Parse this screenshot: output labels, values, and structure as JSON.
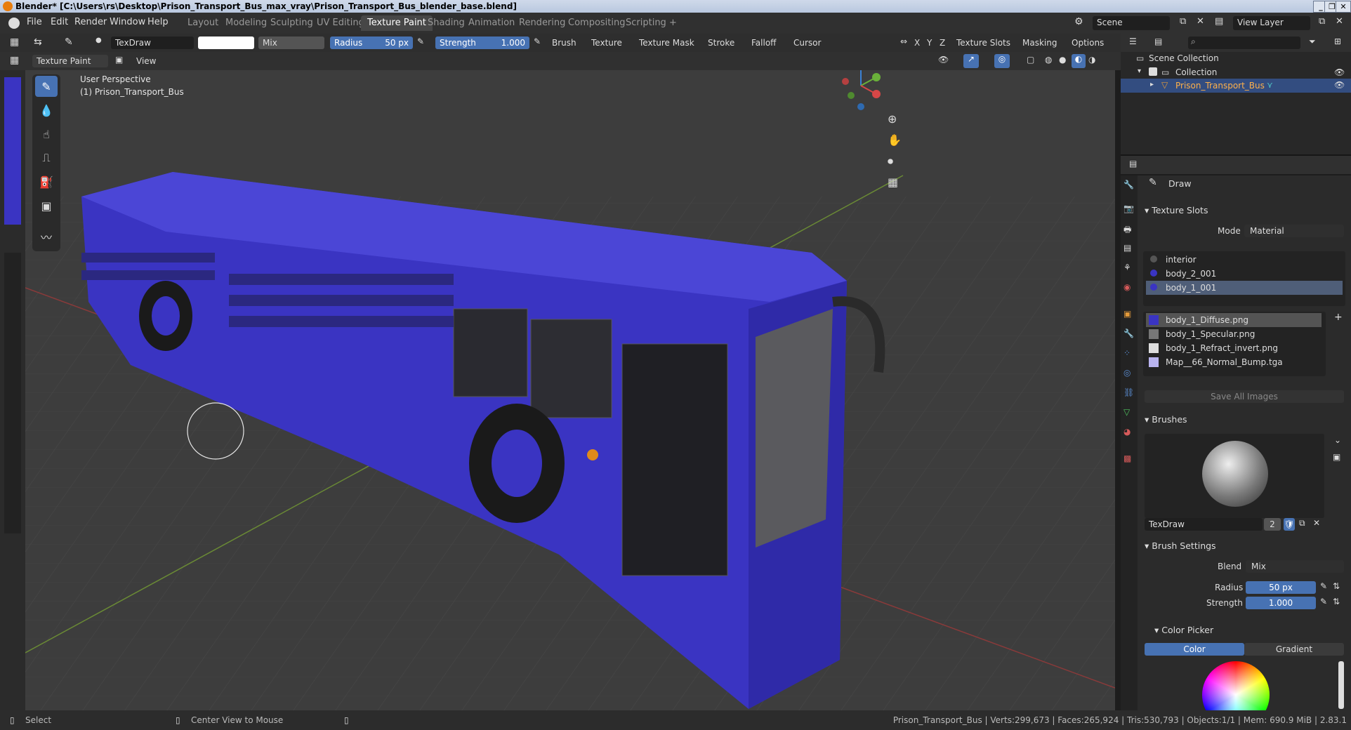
{
  "window": {
    "title": "Blender* [C:\\Users\\rs\\Desktop\\Prison_Transport_Bus_max_vray\\Prison_Transport_Bus_blender_base.blend]",
    "buttons": [
      "_",
      "❐",
      "✕"
    ]
  },
  "menubar": {
    "menus": [
      "File",
      "Edit",
      "Render",
      "Window",
      "Help"
    ],
    "workspaces": [
      "Layout",
      "Modeling",
      "Sculpting",
      "UV Editing",
      "Texture Paint",
      "Shading",
      "Animation",
      "Rendering",
      "Compositing",
      "Scripting"
    ],
    "active_workspace": "Texture Paint",
    "add_tab": "+",
    "scene": "Scene",
    "view_layer": "View Layer"
  },
  "toolheader": {
    "brush_name": "TexDraw",
    "blend": "Mix",
    "radius_label": "Radius",
    "radius_value": "50 px",
    "strength_label": "Strength",
    "strength_value": "1.000",
    "menus": [
      "Brush",
      "Texture",
      "Texture Mask",
      "Stroke",
      "Falloff",
      "Cursor"
    ],
    "axes": [
      "X",
      "Y",
      "Z"
    ],
    "right_menus": [
      "Texture Slots",
      "Masking",
      "Options"
    ],
    "color_swatch": "#ffffff"
  },
  "viewheader": {
    "mode": "Texture Paint",
    "view": "View"
  },
  "viewport": {
    "perspective": "User Perspective",
    "object": "(1) Prison_Transport_Bus",
    "bg": "#3d3d3d",
    "bus_color": "#3a34c2"
  },
  "outliner": {
    "root": "Scene Collection",
    "collection": "Collection",
    "object": "Prison_Transport_Bus"
  },
  "properties": {
    "tool_name": "Draw",
    "texture_slots_title": "Texture Slots",
    "mode_label": "Mode",
    "mode_value": "Material",
    "materials": [
      "interior",
      "body_2_001",
      "body_1_001"
    ],
    "selected_material": 2,
    "images": [
      "body_1_Diffuse.png",
      "body_1_Specular.png",
      "body_1_Refract_invert.png",
      "Map__66_Normal_Bump.tga"
    ],
    "selected_image": 0,
    "save_all": "Save All Images",
    "brushes_title": "Brushes",
    "brush_name": "TexDraw",
    "brush_users": "2",
    "brush_settings_title": "Brush Settings",
    "blend_label": "Blend",
    "blend_value": "Mix",
    "radius_label": "Radius",
    "radius_value": "50 px",
    "strength_label": "Strength",
    "strength_value": "1.000",
    "color_picker_title": "Color Picker",
    "color_tab": "Color",
    "gradient_tab": "Gradient"
  },
  "statusbar": {
    "select": "Select",
    "center_view": "Center View to Mouse",
    "stats": "Prison_Transport_Bus | Verts:299,673 | Faces:265,924 | Tris:530,793 | Objects:1/1 | Mem: 690.9 MiB | 2.83.1"
  }
}
